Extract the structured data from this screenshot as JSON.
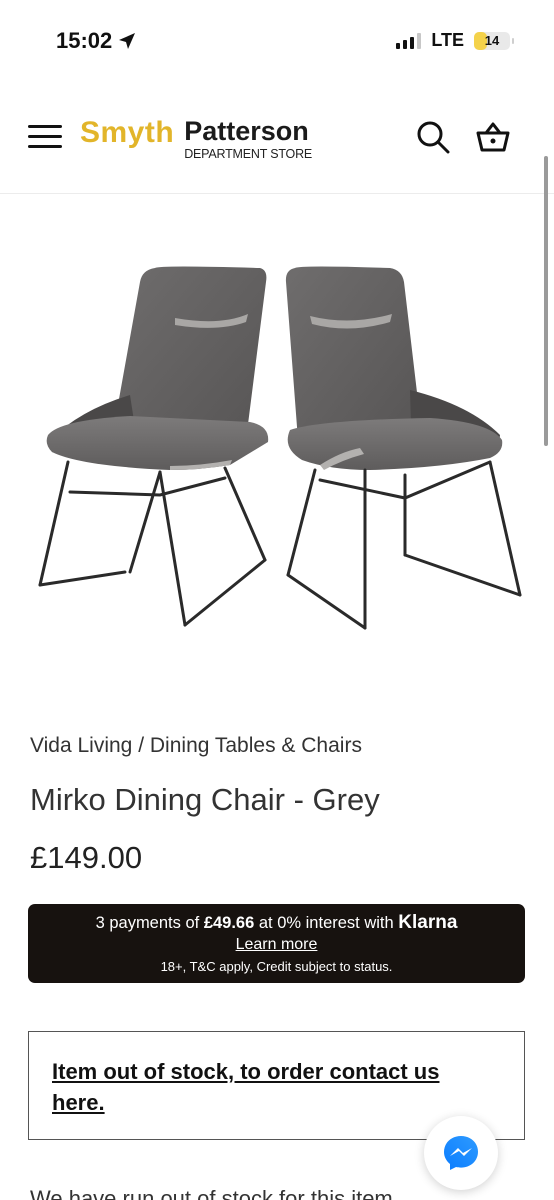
{
  "status_bar": {
    "time": "15:02",
    "network": "LTE",
    "battery": "14",
    "battery_level": 0.14
  },
  "header": {
    "logo_primary": "Smyth",
    "logo_secondary": "Patterson",
    "logo_subtitle": "DEPARTMENT STORE",
    "icons": [
      "menu-icon",
      "search-icon",
      "basket-icon"
    ]
  },
  "product": {
    "breadcrumb_brand": "Vida Living",
    "breadcrumb_separator": "/",
    "breadcrumb_category": "Dining Tables & Chairs",
    "title": "Mirko Dining Chair - Grey",
    "price": "£149.00"
  },
  "klarna": {
    "prefix": "3 payments of ",
    "amount": "£49.66",
    "middle": " at 0% interest with ",
    "brand": "Klarna",
    "learn_more": "Learn more",
    "terms": "18+, T&C apply, Credit subject to status."
  },
  "stock": {
    "message": "Item out of stock, to order contact us here."
  },
  "footer_partial": {
    "text": "We have run out of stock for this item."
  },
  "colors": {
    "brand_gold": "#e2b52a",
    "klarna_bg": "#17120f",
    "messenger_blue": "#1e6ff2"
  }
}
